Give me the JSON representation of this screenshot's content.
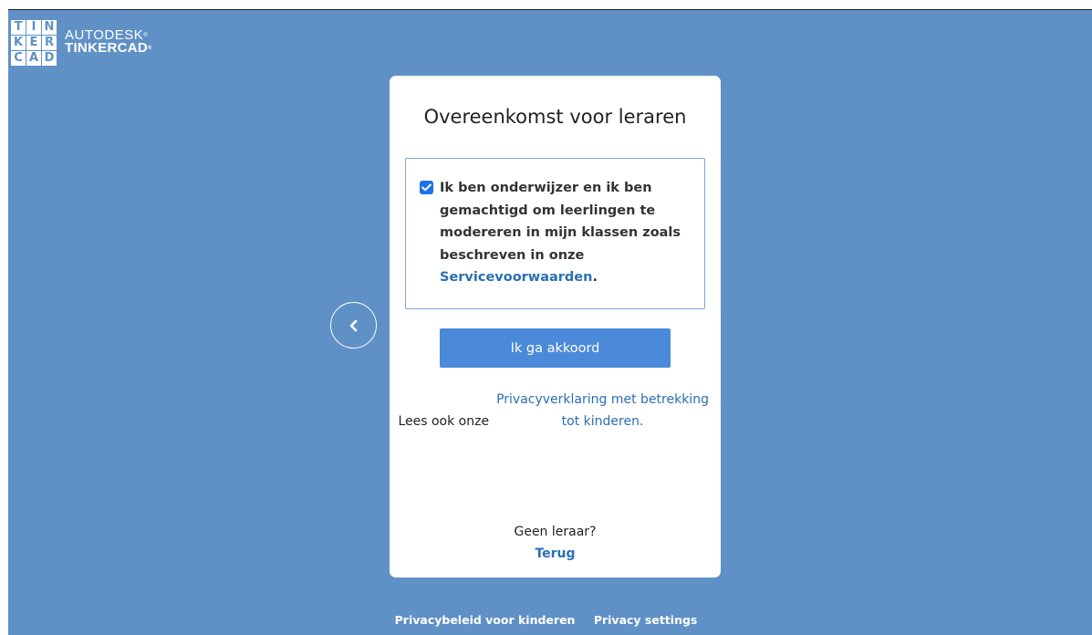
{
  "logo": {
    "cells": [
      "T",
      "I",
      "N",
      "K",
      "E",
      "R",
      "C",
      "A",
      "D"
    ],
    "line1": "AUTODESK",
    "line2": "TINKERCAD"
  },
  "colors": {
    "background": "#5f91c6",
    "button": "#4a8ad8",
    "link": "#2a6fb3",
    "checkbox": "#1a73e8"
  },
  "back_button": {
    "icon": "chevron-left-icon"
  },
  "card": {
    "title": "Overeenkomst voor leraren",
    "agreement": {
      "checked": true,
      "text": "Ik ben onderwijzer en ik ben gemachtigd om leerlingen te modereren in mijn klassen zoals beschreven in onze",
      "link": "Servicevoorwaarden",
      "suffix": "."
    },
    "agree_button": "Ik ga akkoord",
    "privacy_note": {
      "prefix": "Lees ook onze",
      "link": "Privacyverklaring met betrekking tot kinderen."
    },
    "no_teacher": "Geen leraar?",
    "back_link": "Terug"
  },
  "footer": {
    "privacy_children": "Privacybeleid voor kinderen",
    "privacy_settings": "Privacy settings"
  }
}
